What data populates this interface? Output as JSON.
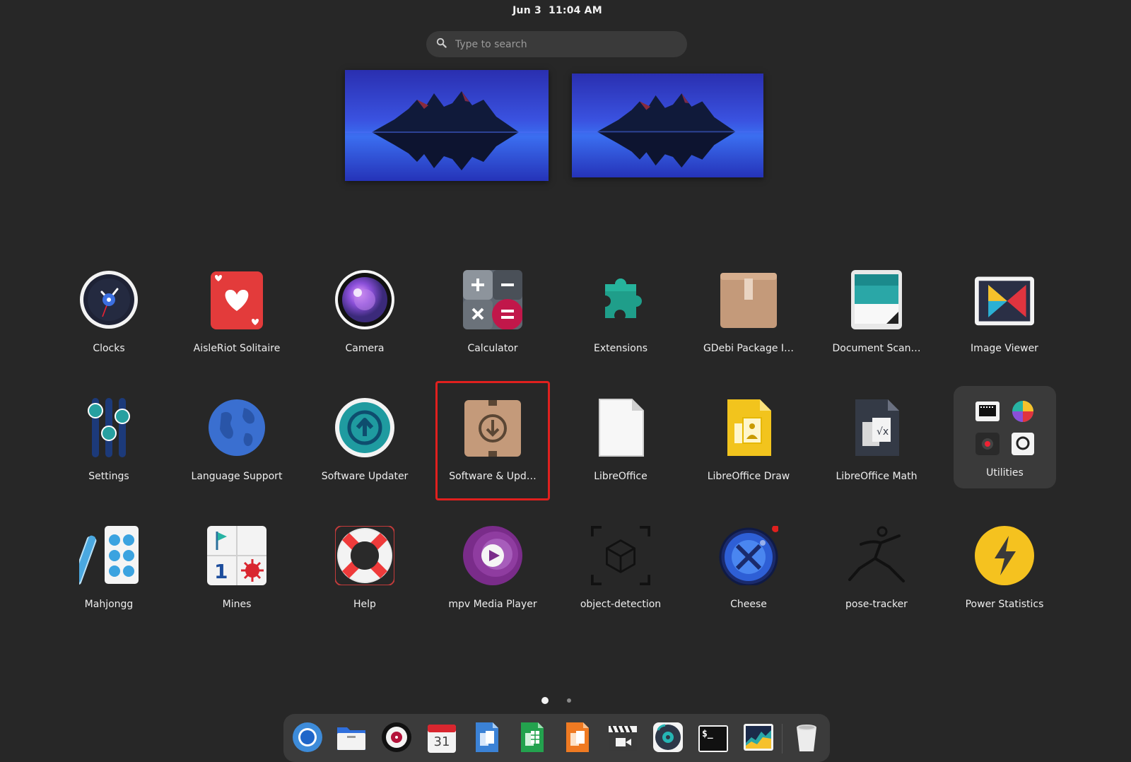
{
  "topbar": {
    "date": "Jun 3",
    "time": "11:04 AM"
  },
  "search": {
    "placeholder": "Type to search",
    "icon": "search-icon"
  },
  "workspaces": [
    {
      "label": "workspace-1"
    },
    {
      "label": "workspace-2"
    }
  ],
  "apps": [
    {
      "label": "Clocks",
      "icon": "clock-icon"
    },
    {
      "label": "AisleRiot Solitaire",
      "icon": "card-heart-icon"
    },
    {
      "label": "Camera",
      "icon": "camera-lens-icon"
    },
    {
      "label": "Calculator",
      "icon": "calculator-icon"
    },
    {
      "label": "Extensions",
      "icon": "puzzle-icon"
    },
    {
      "label": "GDebi Package I…",
      "icon": "package-box-icon"
    },
    {
      "label": "Document Scan…",
      "icon": "scanner-icon"
    },
    {
      "label": "Image Viewer",
      "icon": "image-viewer-icon"
    },
    {
      "label": "Settings",
      "icon": "sliders-icon"
    },
    {
      "label": "Language Support",
      "icon": "globe-icon"
    },
    {
      "label": "Software Updater",
      "icon": "update-arrow-icon"
    },
    {
      "label": "Software & Upd…",
      "icon": "software-box-icon"
    },
    {
      "label": "LibreOffice",
      "icon": "document-icon"
    },
    {
      "label": "LibreOffice Draw",
      "icon": "draw-doc-icon"
    },
    {
      "label": "LibreOffice Math",
      "icon": "math-doc-icon"
    },
    {
      "label": "Utilities",
      "icon": "folder-grid-icon"
    },
    {
      "label": "Mahjongg",
      "icon": "mahjong-tile-icon"
    },
    {
      "label": "Mines",
      "icon": "mines-icon"
    },
    {
      "label": "Help",
      "icon": "lifebuoy-icon"
    },
    {
      "label": "mpv Media Player",
      "icon": "play-circle-icon"
    },
    {
      "label": "object-detection",
      "icon": "cube-frame-icon"
    },
    {
      "label": "Cheese",
      "icon": "webcam-icon"
    },
    {
      "label": "pose-tracker",
      "icon": "running-figure-icon"
    },
    {
      "label": "Power Statistics",
      "icon": "lightning-icon"
    }
  ],
  "pages": {
    "current": 1,
    "total": 2
  },
  "dock": [
    {
      "name": "chromium",
      "icon": "browser-icon"
    },
    {
      "name": "files",
      "icon": "folder-icon"
    },
    {
      "name": "rhythmbox",
      "icon": "music-player-icon"
    },
    {
      "name": "calendar",
      "icon": "calendar-icon",
      "text": "31"
    },
    {
      "name": "writer",
      "icon": "writer-icon"
    },
    {
      "name": "calc",
      "icon": "spreadsheet-icon"
    },
    {
      "name": "impress",
      "icon": "presentation-icon"
    },
    {
      "name": "videos",
      "icon": "clapper-icon"
    },
    {
      "name": "music",
      "icon": "disc-icon"
    },
    {
      "name": "terminal",
      "icon": "terminal-icon",
      "text": "$_"
    },
    {
      "name": "system-monitor",
      "icon": "monitor-graph-icon"
    },
    {
      "name": "trash",
      "icon": "trash-icon"
    }
  ],
  "colors": {
    "background": "#272727",
    "highlight": "#e0201e",
    "search_bg": "#3a3a3a",
    "dock_bg": "#3b3b3b"
  }
}
